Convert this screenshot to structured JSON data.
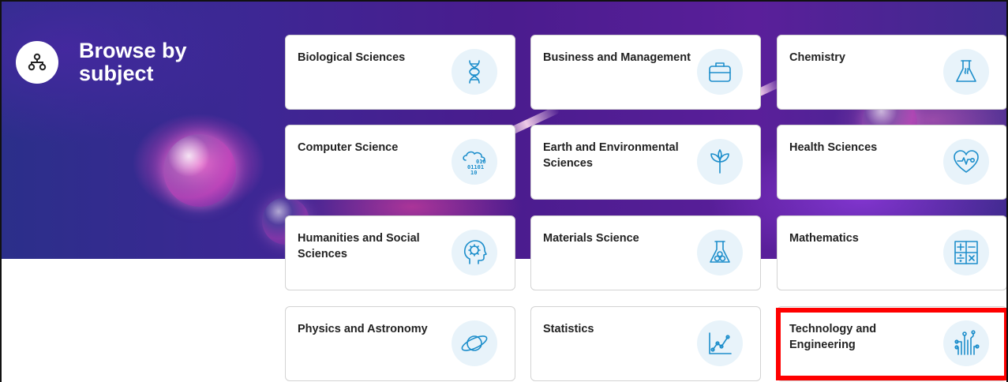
{
  "header": {
    "title": "Browse by subject",
    "icon": "network-icon"
  },
  "subjects": [
    {
      "label": "Biological Sciences",
      "icon": "dna-icon"
    },
    {
      "label": "Business and Management",
      "icon": "briefcase-icon"
    },
    {
      "label": "Chemistry",
      "icon": "flask-icon"
    },
    {
      "label": "Computer Science",
      "icon": "cloud-binary-icon"
    },
    {
      "label": "Earth and Environmental Sciences",
      "icon": "leaf-icon"
    },
    {
      "label": "Health Sciences",
      "icon": "heartbeat-icon"
    },
    {
      "label": "Humanities and Social Sciences",
      "icon": "head-gear-icon"
    },
    {
      "label": "Materials Science",
      "icon": "beaker-icon"
    },
    {
      "label": "Mathematics",
      "icon": "calculator-icon"
    },
    {
      "label": "Physics and Astronomy",
      "icon": "planet-icon"
    },
    {
      "label": "Statistics",
      "icon": "line-chart-icon"
    },
    {
      "label": "Technology and Engineering",
      "icon": "circuit-icon"
    }
  ],
  "colors": {
    "accent": "#1d8ecb",
    "icon_bg": "#e8f3fa",
    "highlight": "#ff0000"
  },
  "highlighted_subject": "Technology and Engineering",
  "binary_text": [
    "010",
    "01101",
    "10"
  ]
}
